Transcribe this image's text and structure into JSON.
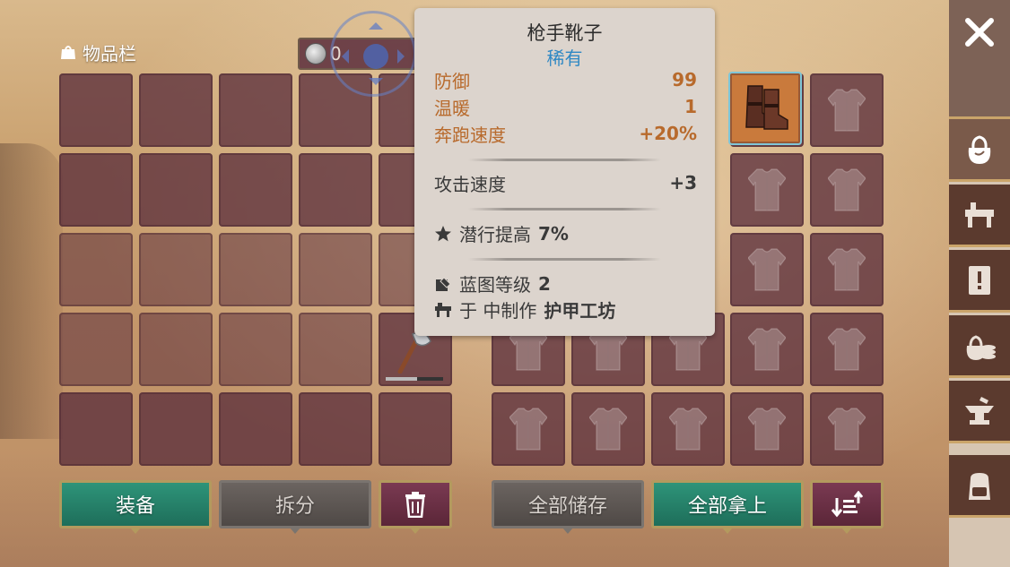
{
  "inventory": {
    "title": "物品栏",
    "currency_amount": "0"
  },
  "tooltip": {
    "item_name": "枪手靴子",
    "rarity": "稀有",
    "stats": [
      {
        "label": "防御",
        "value": "99"
      },
      {
        "label": "温暖",
        "value": "1"
      },
      {
        "label": "奔跑速度",
        "value": "+20%"
      }
    ],
    "attack_speed": {
      "label": "攻击速度",
      "value": "+3"
    },
    "perk": {
      "prefix": "潜行提高",
      "value": "7%"
    },
    "blueprint": {
      "prefix": "蓝图等级",
      "value": "2"
    },
    "crafting": {
      "prefix": "于 中制作",
      "station": "护甲工坊"
    }
  },
  "buttons": {
    "equip": "装备",
    "split": "拆分",
    "store_all": "全部储存",
    "take_all": "全部拿上"
  },
  "colors": {
    "rarity": "#2f88c4",
    "stat_accent": "#b86a2c",
    "green_button": "#2e9479",
    "slot_bg": "#5c303c"
  },
  "sidebar_tabs": [
    "close-icon",
    "inventory-bag-icon",
    "workbench-icon",
    "quest-scroll-icon",
    "loot-money-icon",
    "anvil-icon",
    "backpack-icon"
  ]
}
